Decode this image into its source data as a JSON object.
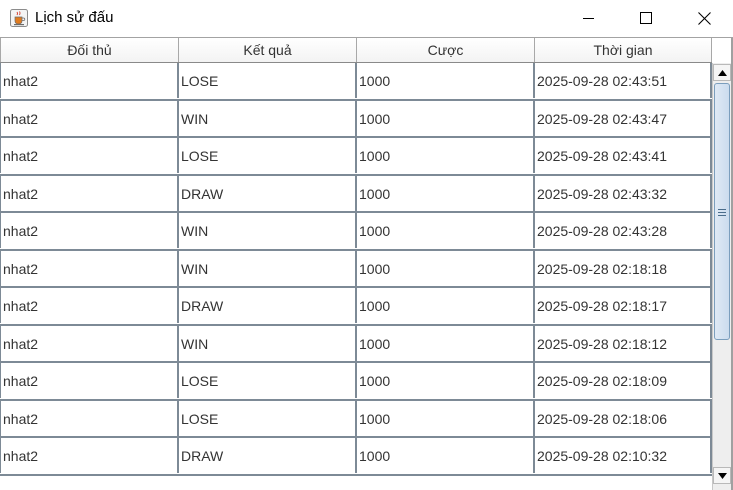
{
  "window": {
    "title": "Lịch sử đấu",
    "icon": "java-cup-icon",
    "controls": [
      "minimize-icon",
      "maximize-icon",
      "close-icon"
    ]
  },
  "table": {
    "columns": [
      "Đối thủ",
      "Kết quả",
      "Cược",
      "Thời gian"
    ],
    "rows": [
      {
        "opponent": "nhat2",
        "result": "LOSE",
        "bet": "1000",
        "time": "2025-09-28 02:43:51"
      },
      {
        "opponent": "nhat2",
        "result": "WIN",
        "bet": "1000",
        "time": "2025-09-28 02:43:47"
      },
      {
        "opponent": "nhat2",
        "result": "LOSE",
        "bet": "1000",
        "time": "2025-09-28 02:43:41"
      },
      {
        "opponent": "nhat2",
        "result": "DRAW",
        "bet": "1000",
        "time": "2025-09-28 02:43:32"
      },
      {
        "opponent": "nhat2",
        "result": "WIN",
        "bet": "1000",
        "time": "2025-09-28 02:43:28"
      },
      {
        "opponent": "nhat2",
        "result": "WIN",
        "bet": "1000",
        "time": "2025-09-28 02:18:18"
      },
      {
        "opponent": "nhat2",
        "result": "DRAW",
        "bet": "1000",
        "time": "2025-09-28 02:18:17"
      },
      {
        "opponent": "nhat2",
        "result": "WIN",
        "bet": "1000",
        "time": "2025-09-28 02:18:12"
      },
      {
        "opponent": "nhat2",
        "result": "LOSE",
        "bet": "1000",
        "time": "2025-09-28 02:18:09"
      },
      {
        "opponent": "nhat2",
        "result": "LOSE",
        "bet": "1000",
        "time": "2025-09-28 02:18:06"
      },
      {
        "opponent": "nhat2",
        "result": "DRAW",
        "bet": "1000",
        "time": "2025-09-28 02:10:32"
      }
    ]
  },
  "scrollbar": {
    "position_fraction": 0.0,
    "visible_fraction": 0.6
  },
  "colors": {
    "grid": "#7d8a96",
    "header_border": "#a8a8a8",
    "scroll_thumb": "#cbdcee"
  }
}
